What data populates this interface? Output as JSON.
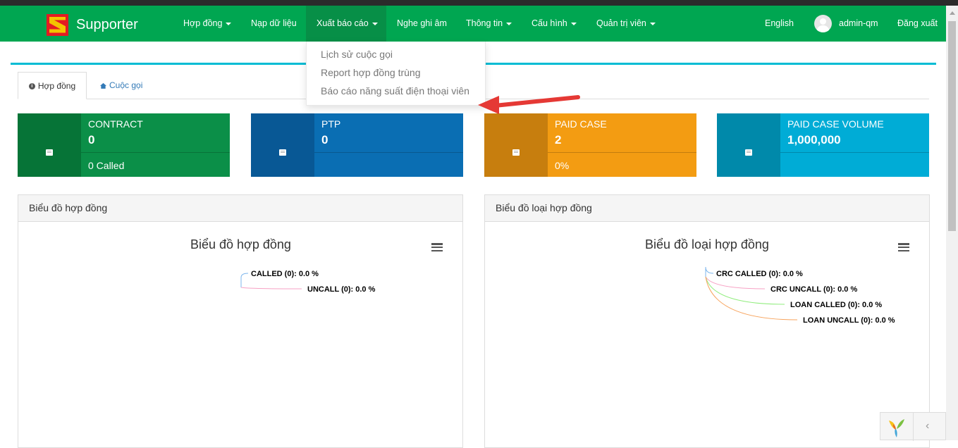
{
  "navbar": {
    "brand": "Supporter",
    "items": [
      {
        "label": "Hợp đồng",
        "caret": true
      },
      {
        "label": "Nạp dữ liệu",
        "caret": false
      },
      {
        "label": "Xuất báo cáo",
        "caret": true,
        "active": true
      },
      {
        "label": "Nghe ghi âm",
        "caret": false
      },
      {
        "label": "Thông tin",
        "caret": true
      },
      {
        "label": "Cấu hình",
        "caret": true
      },
      {
        "label": "Quản trị viên",
        "caret": true
      }
    ],
    "language": "English",
    "username": "admin-qm",
    "logout": "Đăng xuất",
    "colors": {
      "navbar": "#00a651",
      "active": "#078f47",
      "accent": "#00bcd4"
    }
  },
  "dropdown": {
    "items": [
      "Lịch sử cuộc gọi",
      "Report hợp đồng trùng",
      "Báo cáo năng suất điện thoại viên"
    ]
  },
  "tabs": [
    {
      "label": "Hợp đồng",
      "icon": "info-icon",
      "active": true
    },
    {
      "label": "Cuộc gọi",
      "icon": "home-icon",
      "active": false
    }
  ],
  "stats": [
    {
      "title": "CONTRACT",
      "value": "0",
      "sub": "0 Called",
      "icon": "book-icon",
      "color": "#0b8f48",
      "dark": "#067437"
    },
    {
      "title": "PTP",
      "value": "0",
      "sub": "",
      "icon": "book-icon",
      "color": "#0a6eb3",
      "dark": "#085895"
    },
    {
      "title": "PAID CASE",
      "value": "2",
      "sub": "0%",
      "icon": "book-icon",
      "color": "#f39c12",
      "dark": "#c77e0e"
    },
    {
      "title": "PAID CASE VOLUME",
      "value": "1,000,000",
      "sub": "",
      "icon": "book-icon",
      "color": "#00acd6",
      "dark": "#0089aa"
    }
  ],
  "charts": [
    {
      "header": "Biểu đồ hợp đồng",
      "title": "Biểu đồ hợp đồng",
      "labels": [
        "CALLED (0): 0.0 %",
        "UNCALL (0): 0.0 %"
      ],
      "colors": [
        "#7cb5ec",
        "#f7a1c4"
      ]
    },
    {
      "header": "Biểu đồ loại hợp đồng",
      "title": "Biểu đồ loại hợp đồng",
      "labels": [
        "CRC CALLED (0): 0.0 %",
        "CRC UNCALL (0): 0.0 %",
        "LOAN CALLED (0): 0.0 %",
        "LOAN UNCALL (0): 0.0 %"
      ],
      "colors": [
        "#7cb5ec",
        "#f7a1c4",
        "#90ed7d",
        "#f7a35c"
      ]
    }
  ],
  "chart_data": [
    {
      "type": "pie",
      "title": "Biểu đồ hợp đồng",
      "categories": [
        "CALLED",
        "UNCALL"
      ],
      "values": [
        0,
        0
      ],
      "percentages": [
        0.0,
        0.0
      ]
    },
    {
      "type": "pie",
      "title": "Biểu đồ loại hợp đồng",
      "categories": [
        "CRC CALLED",
        "CRC UNCALL",
        "LOAN CALLED",
        "LOAN UNCALL"
      ],
      "values": [
        0,
        0,
        0,
        0
      ],
      "percentages": [
        0.0,
        0.0,
        0.0,
        0.0
      ]
    }
  ]
}
